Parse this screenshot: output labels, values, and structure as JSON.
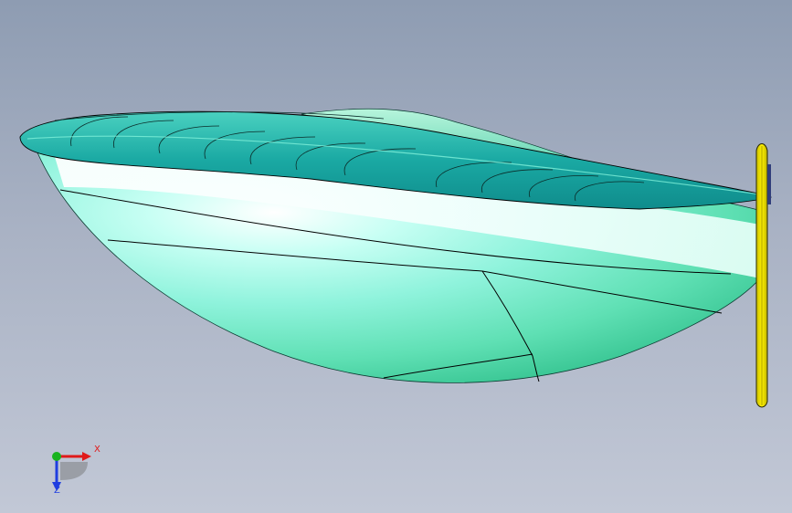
{
  "viewport": {
    "colors": {
      "background_top": "#8e9cb2",
      "background_bottom": "#c2c8d6",
      "hull_main": "#8ff0d8",
      "hull_deck": "#1fb5ab",
      "hull_highlight": "#ffffff",
      "transom_plate": "#f2e600",
      "edge_line": "#000000"
    }
  },
  "triad": {
    "x_label": "X",
    "z_label": "Z",
    "x_color": "#e01a1a",
    "y_color": "#19b31f",
    "z_color": "#1f3ee0"
  }
}
